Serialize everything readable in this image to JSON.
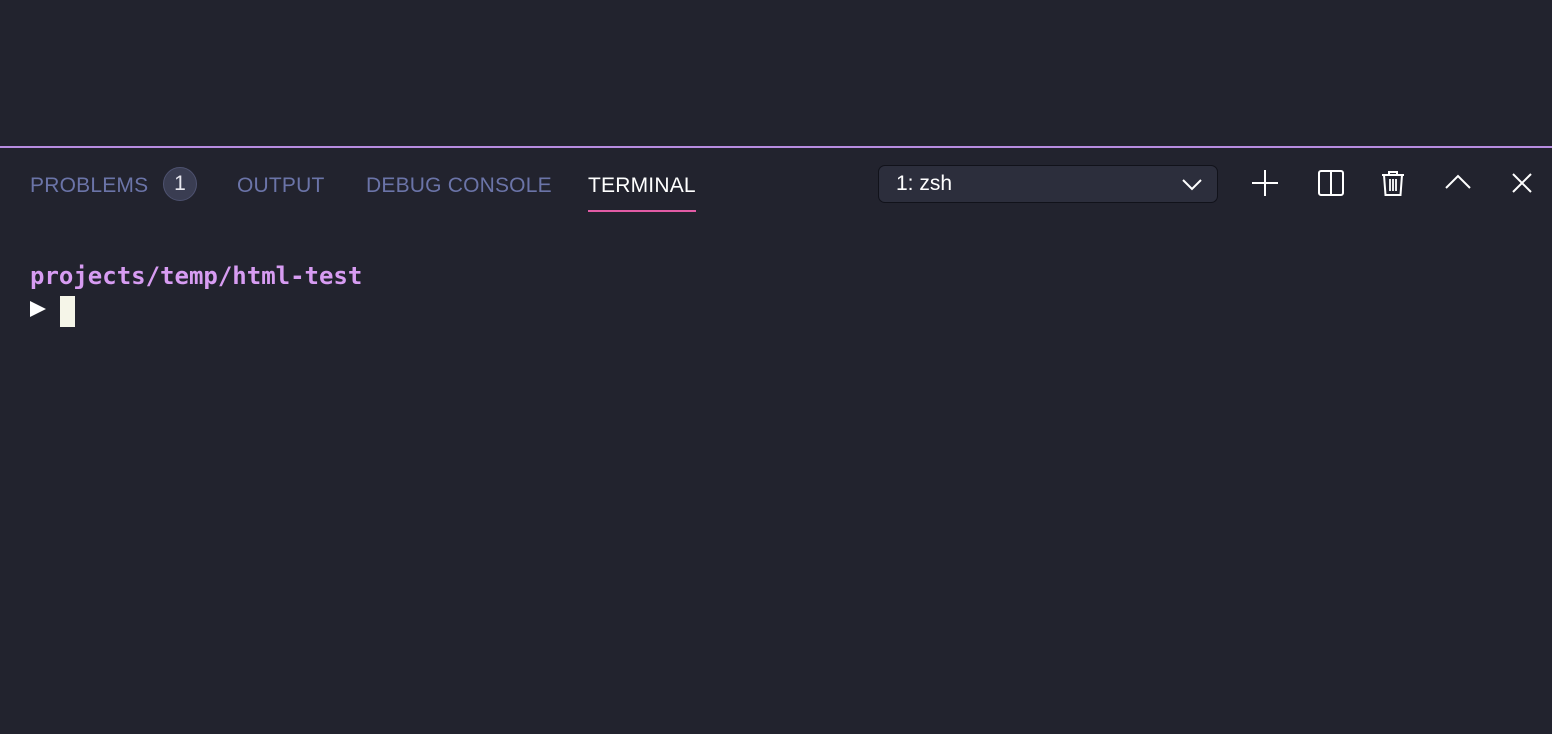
{
  "tabs": [
    {
      "label": "PROBLEMS",
      "active": false
    },
    {
      "label": "OUTPUT",
      "active": false
    },
    {
      "label": "DEBUG CONSOLE",
      "active": false
    },
    {
      "label": "TERMINAL",
      "active": true
    }
  ],
  "problems_count": "1",
  "terminal_select": {
    "value": "1: zsh"
  },
  "toolbar_icons": [
    "plus-icon",
    "split-icon",
    "trash-icon",
    "chevron-up-icon",
    "close-icon"
  ],
  "terminal": {
    "path": "projects/temp/html-test",
    "prompt_icon": "prompt-arrow-icon"
  },
  "colors": {
    "background": "#22232e",
    "accent_border": "#b78ce0",
    "active_tab_underline": "#e25ba5",
    "inactive_tab": "#6b74a8",
    "path": "#d79cf2"
  }
}
